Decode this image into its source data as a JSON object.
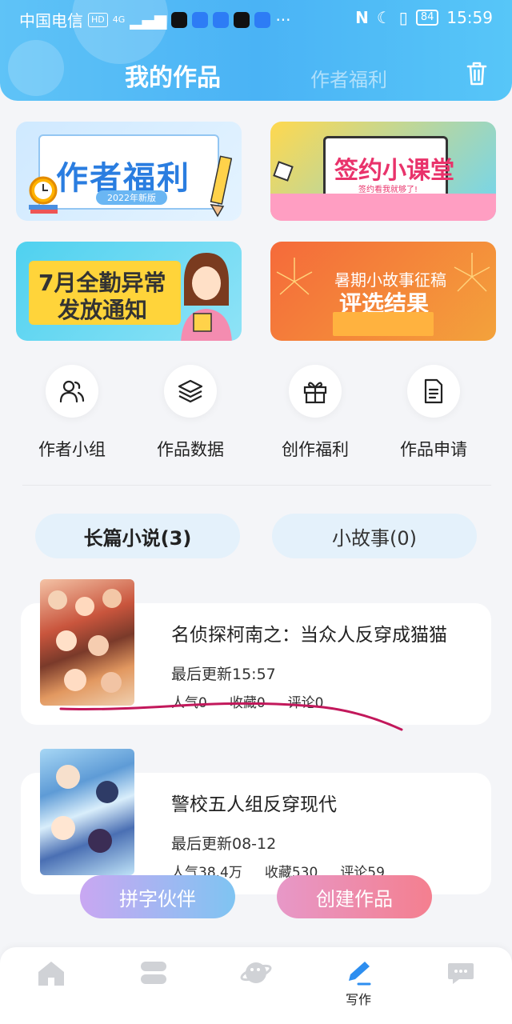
{
  "status_bar": {
    "carrier": "中国电信",
    "hd": "HD",
    "network": "4G",
    "battery": "84",
    "time": "15:59"
  },
  "header": {
    "title_active": "我的作品",
    "title_inactive": "作者福利"
  },
  "banners": [
    {
      "title": "作者福利",
      "subtitle": "2022年新版"
    },
    {
      "title": "签约小课堂",
      "subtitle": "签约看我就够了!"
    },
    {
      "title_line1": "7月全勤异常",
      "title_line2": "发放通知"
    },
    {
      "title_line1": "暑期小故事征稿",
      "title_line2": "评选结果"
    }
  ],
  "quick_actions": [
    {
      "label": "作者小组",
      "icon": "people-icon"
    },
    {
      "label": "作品数据",
      "icon": "layers-icon"
    },
    {
      "label": "创作福利",
      "icon": "gift-icon"
    },
    {
      "label": "作品申请",
      "icon": "document-icon"
    }
  ],
  "categories": {
    "active": "长篇小说(3)",
    "inactive": "小故事(0)"
  },
  "works": [
    {
      "title": "名侦探柯南之：当众人反穿成猫猫",
      "updated": "最后更新15:57",
      "popularity": "人气0",
      "favorites": "收藏0",
      "comments": "评论0"
    },
    {
      "title": "警校五人组反穿现代",
      "updated": "最后更新08-12",
      "popularity": "人气38.4万",
      "favorites": "收藏530",
      "comments": "评论59"
    }
  ],
  "floating_buttons": {
    "left": "拼字伙伴",
    "right": "创建作品"
  },
  "bottom_nav": {
    "active_label": "写作"
  },
  "colors": {
    "header": "#4ab3f5",
    "accent_pink": "#f47f8f",
    "category_bg": "#e4f1fb",
    "annotation_stroke": "#c2185b"
  }
}
